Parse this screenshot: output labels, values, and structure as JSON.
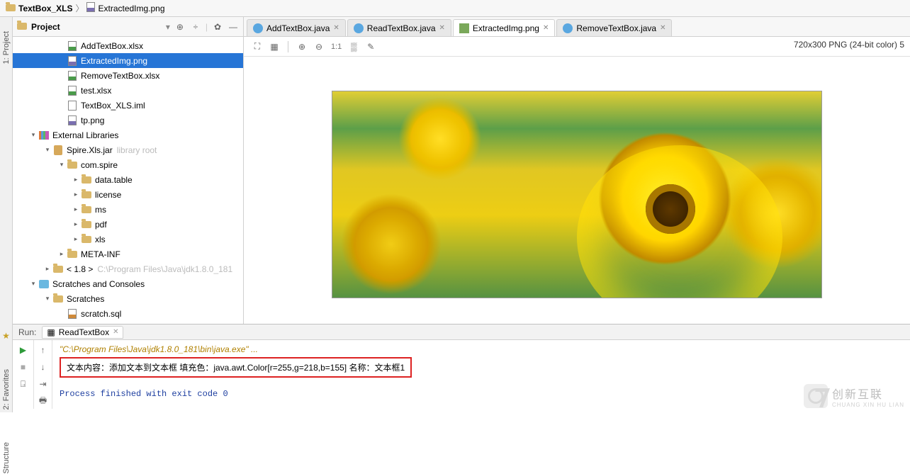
{
  "breadcrumb": {
    "seg1": "TextBox_XLS",
    "seg2": "ExtractedImg.png"
  },
  "project_panel": {
    "title": "Project",
    "tree": {
      "n0": "AddTextBox.xlsx",
      "n1": "ExtractedImg.png",
      "n2": "RemoveTextBox.xlsx",
      "n3": "test.xlsx",
      "n4": "TextBox_XLS.iml",
      "n5": "tp.png",
      "ext": "External Libraries",
      "jar": "Spire.Xls.jar",
      "jar_hint": "library root",
      "pkg": "com.spire",
      "p0": "data.table",
      "p1": "license",
      "p2": "ms",
      "p3": "pdf",
      "p4": "xls",
      "meta": "META-INF",
      "jdk": "< 1.8 >",
      "jdk_path": "C:\\Program Files\\Java\\jdk1.8.0_181",
      "scratches": "Scratches and Consoles",
      "scratches2": "Scratches",
      "scratch_file": "scratch.sql"
    }
  },
  "side_tabs": {
    "project": "1: Project",
    "favorites": "2: Favorites",
    "structure": "Structure"
  },
  "editor_tabs": {
    "t0": "AddTextBox.java",
    "t1": "ReadTextBox.java",
    "t2": "ExtractedImg.png",
    "t3": "RemoveTextBox.java"
  },
  "img_toolbar": {
    "ratio": "1:1"
  },
  "img_meta": "720x300 PNG (24-bit color) 5",
  "run": {
    "label": "Run:",
    "tab": "ReadTextBox",
    "cmd": "\"C:\\Program Files\\Java\\jdk1.8.0_181\\bin\\java.exe\" ...",
    "output": "文本内容：添加文本到文本框 填充色：java.awt.Color[r=255,g=218,b=155] 名称：文本框1",
    "exit": "Process finished with exit code 0"
  },
  "watermark": {
    "line1": "创新互联",
    "line2": "CHUANG XIN HU LIAN"
  }
}
